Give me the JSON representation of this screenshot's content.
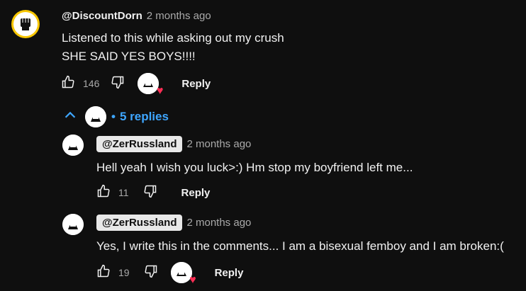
{
  "main_comment": {
    "handle": "@DiscountDorn",
    "time": "2 months ago",
    "lines": [
      "Listened to this while asking out my crush",
      "SHE SAID YES BOYS!!!!"
    ],
    "likes": "146",
    "reply_label": "Reply"
  },
  "replies_toggle": {
    "label": "5 replies",
    "dot": "•"
  },
  "replies": [
    {
      "handle": "@ZerRussland",
      "time": "2 months ago",
      "text": "Hell yeah I wish you luck>:) Hm stop my boyfriend left me...",
      "likes": "11",
      "reply_label": "Reply"
    },
    {
      "handle": "@ZerRussland",
      "time": "2 months ago",
      "text": "Yes, I write this in the comments... I am a bisexual femboy and I am broken:(",
      "likes": "19",
      "reply_label": "Reply"
    }
  ],
  "colors": {
    "background": "#0f0f0f",
    "accent_link": "#3ea6ff",
    "muted": "#aaaaaa",
    "heart": "#ff2e55",
    "avatar_ring": "#f7c600"
  }
}
